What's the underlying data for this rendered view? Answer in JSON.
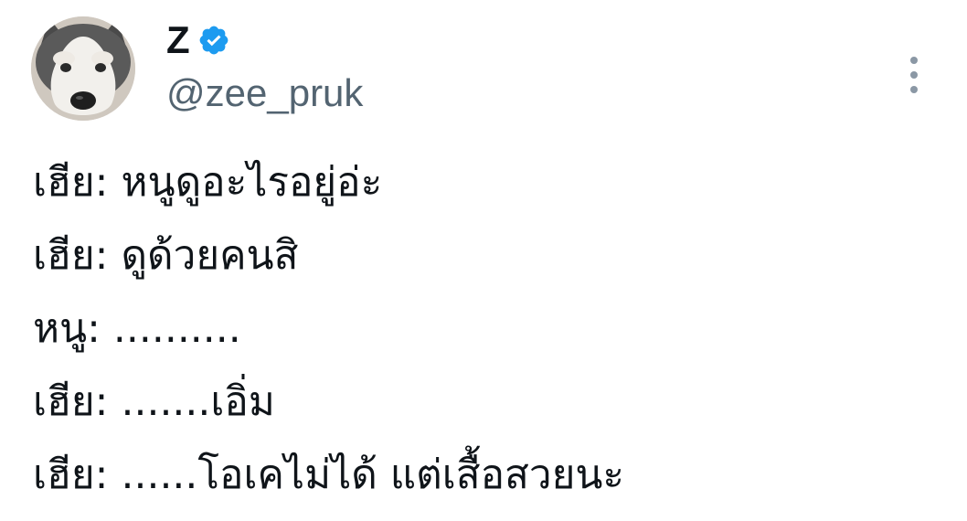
{
  "author": {
    "display_name": "Z",
    "handle": "@zee_pruk",
    "verified": true,
    "avatar_icon": "husky-dog-avatar"
  },
  "menu_icon": "more-vertical-icon",
  "colors": {
    "verified_blue": "#1d9bf0",
    "text": "#0f1419",
    "secondary_text": "#536471"
  },
  "tweet": {
    "lines": [
      "เฮีย: หนูดูอะไรอยู่อ่ะ",
      "เฮีย: ดูด้วยคนสิ",
      "หนู: ..........",
      "เฮีย: .......เอิ่ม",
      "เฮีย: ......โอเคไม่ได้ แต่เสื้อสวยนะ"
    ]
  }
}
